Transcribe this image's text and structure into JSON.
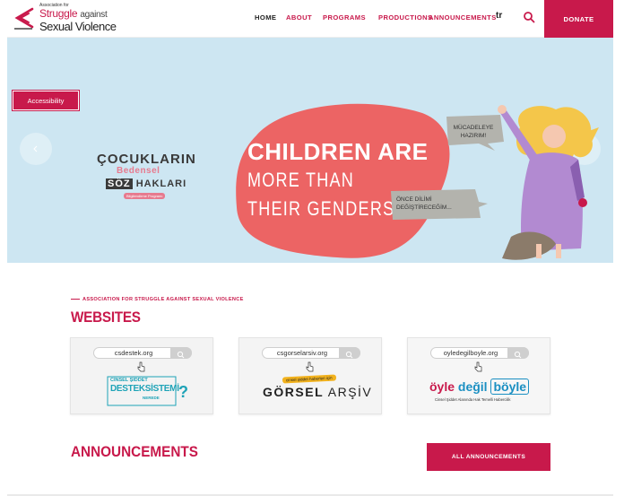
{
  "colors": {
    "brand": "#c8194b",
    "hero_bg": "#cde6f2",
    "blob": "#ec6464",
    "teal": "#1ea3b7"
  },
  "logo": {
    "small": "Association for",
    "line1a": "Struggle",
    "line1b": "against",
    "line2": "Sexual Violence"
  },
  "nav": {
    "home": "HOME",
    "about": "ABOUT",
    "programs": "PROGRAMS",
    "productions": "PRODUCTIONS",
    "announcements": "ANNOUNCEMENTS",
    "lang": "tr",
    "search_icon": "search-icon",
    "donate": "DONATE"
  },
  "hero": {
    "accessibility": "Accessibility",
    "cocuk_1": "ÇOCUKLARIN",
    "cocuk_2": "Bedensel",
    "cocuk_3a": "SÖZ",
    "cocuk_3b": "HAKLARI",
    "cocuk_4": "Bilgilendirme Programı",
    "headline1": "CHILDREN ARE",
    "headline2": "MORE THAN",
    "headline3": "THEIR GENDERS",
    "bubble1": "MÜCADELEYE HAZIRIM!",
    "bubble2": "ÖNCE DİLİMİ DEĞİŞTİRECEĞİM...",
    "prev_icon": "chevron-left-icon",
    "next_icon": "chevron-right-icon"
  },
  "websites": {
    "tag": "ASSOCIATION FOR STRUGGLE AGAINST SEXUAL VIOLENCE",
    "title": "WEBSITES",
    "cards": [
      {
        "url": "csdestek.org",
        "l1": "CİNSEL ŞİDDET",
        "l2": "DESTEKSİSTEMİ",
        "l3": "NEREDE",
        "q": "?"
      },
      {
        "url": "csgorselarsiv.org",
        "tag": "cinsel şiddet haberleri için",
        "name_a": "GÖRSEL",
        "name_b": " ARŞİV"
      },
      {
        "url": "oyledegilboyle.org",
        "a": "öyle",
        "b": " değil ",
        "c": "böyle",
        "sub": "Cinsel Şiddet Alanında Hak Temelli Habercilik"
      }
    ]
  },
  "announcements": {
    "title": "ANNOUNCEMENTS",
    "all_button": "ALL ANNOUNCEMENTS"
  }
}
